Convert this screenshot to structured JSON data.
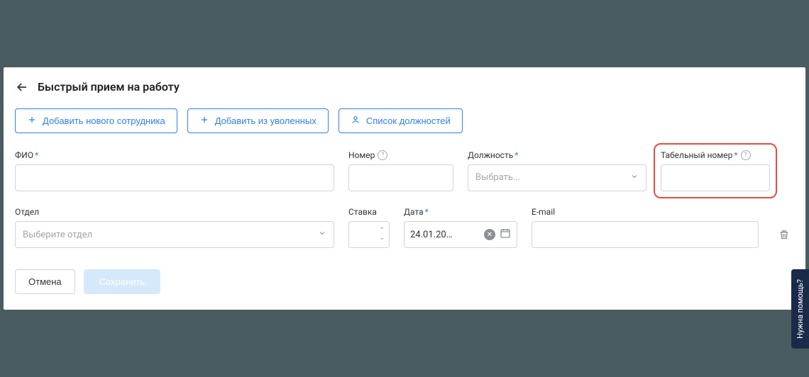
{
  "header": {
    "title": "Быстрый прием на работу"
  },
  "actions": {
    "add_new": "Добавить нового сотрудника",
    "add_from_fired": "Добавить из уволенных",
    "positions_list": "Список должностей"
  },
  "form": {
    "fio": {
      "label": "ФИО"
    },
    "number": {
      "label": "Номер"
    },
    "position": {
      "label": "Должность",
      "placeholder": "Выбрать..."
    },
    "tabnum": {
      "label": "Табельный номер"
    },
    "dept": {
      "label": "Отдел",
      "placeholder": "Выберите отдел"
    },
    "rate": {
      "label": "Ставка"
    },
    "date": {
      "label": "Дата",
      "value": "24.01.20…"
    },
    "email": {
      "label": "E-mail"
    }
  },
  "footer": {
    "cancel": "Отмена",
    "save": "Сохранить"
  },
  "help_tab": "Нужна помощь?"
}
